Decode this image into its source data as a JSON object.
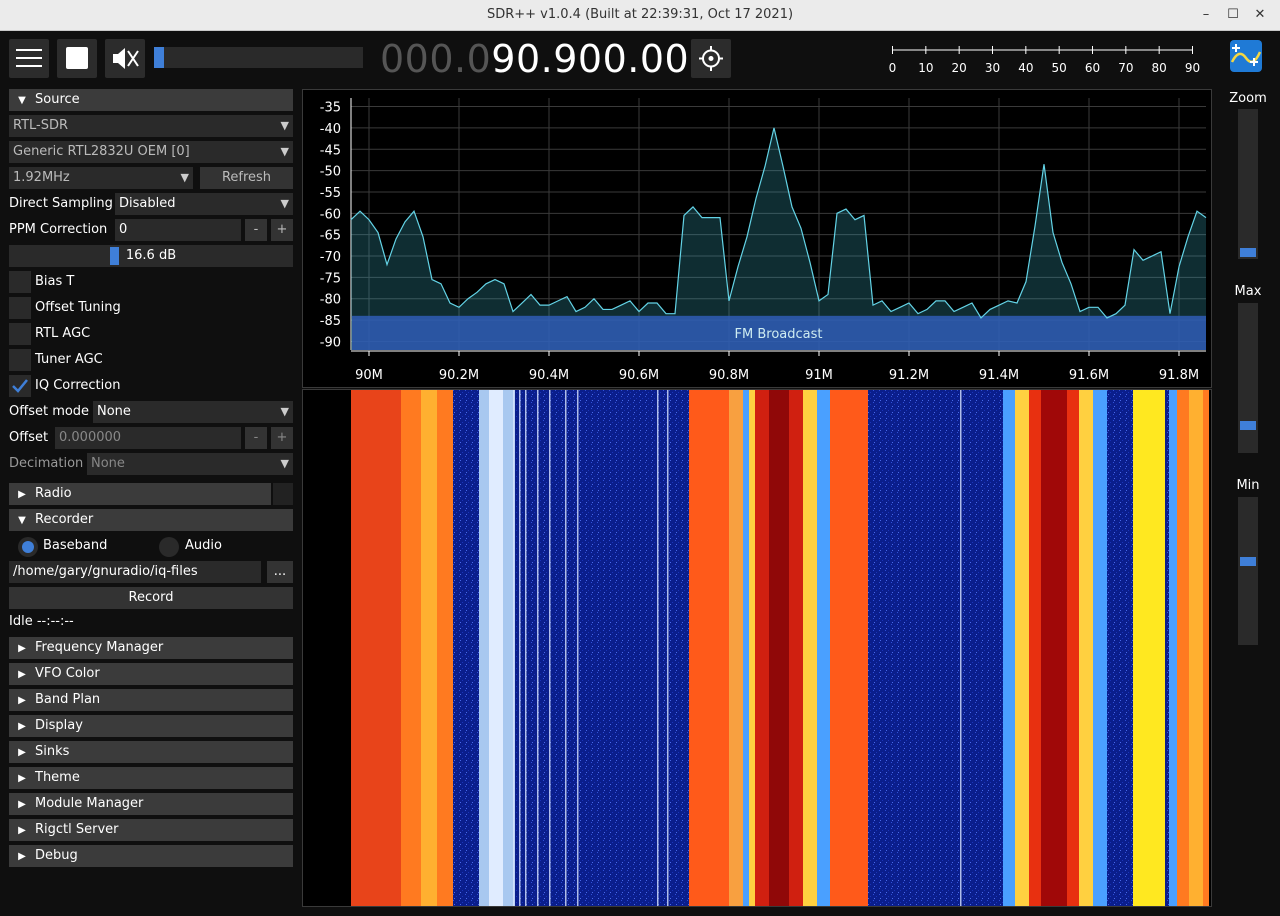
{
  "window": {
    "title": "SDR++ v1.0.4 (Built at 22:39:31, Oct 17 2021)"
  },
  "top": {
    "frequency_dim": "000.0",
    "frequency_bright": "90.900.000",
    "volume_level": 0.05,
    "snr_ticks": [
      "0",
      "10",
      "20",
      "30",
      "40",
      "50",
      "60",
      "70",
      "80",
      "90"
    ]
  },
  "source": {
    "header": "Source",
    "device": "RTL-SDR",
    "device_name": "Generic RTL2832U OEM [0]",
    "sample_rate": "1.92MHz",
    "refresh": "Refresh",
    "direct_sampling_label": "Direct Sampling",
    "direct_sampling_value": "Disabled",
    "ppm_label": "PPM Correction",
    "ppm_value": "0",
    "minus": "-",
    "plus": "+",
    "gain": "16.6 dB",
    "gain_fraction": 0.36,
    "bias_t": "Bias T",
    "offset_tuning": "Offset Tuning",
    "rtl_agc": "RTL AGC",
    "tuner_agc": "Tuner AGC",
    "iq_correction": "IQ Correction",
    "offset_mode_label": "Offset mode",
    "offset_mode_value": "None",
    "offset_label": "Offset",
    "offset_value": "0.000000",
    "decimation_label": "Decimation",
    "decimation_value": "None"
  },
  "radio": {
    "header": "Radio"
  },
  "recorder": {
    "header": "Recorder",
    "baseband": "Baseband",
    "audio": "Audio",
    "path": "/home/gary/gnuradio/iq-files",
    "browse": "...",
    "record": "Record",
    "status": "Idle --:--:--"
  },
  "menus": [
    "Frequency Manager",
    "VFO Color",
    "Band Plan",
    "Display",
    "Sinks",
    "Theme",
    "Module Manager",
    "Rigctl Server",
    "Debug"
  ],
  "right": {
    "zoom": "Zoom",
    "max": "Max",
    "min": "Min",
    "zoom_level": 0.0,
    "max_level": 0.15,
    "min_level": 0.57
  },
  "chart_data": {
    "type": "area",
    "yticks": [
      "-35",
      "-40",
      "-45",
      "-50",
      "-55",
      "-60",
      "-65",
      "-70",
      "-75",
      "-80",
      "-85",
      "-90"
    ],
    "xticks": [
      "90M",
      "90.2M",
      "90.4M",
      "90.6M",
      "90.8M",
      "91M",
      "91.2M",
      "91.4M",
      "91.6M",
      "91.8M"
    ],
    "xlim": [
      89.96,
      91.86
    ],
    "ylim": [
      -92,
      -33
    ],
    "band_label": "FM Broadcast",
    "series": [
      {
        "x": [
          89.96,
          89.98,
          90.0,
          90.02,
          90.04,
          90.06,
          90.08,
          90.1,
          90.12,
          90.14,
          90.16,
          90.18,
          90.2,
          90.22,
          90.24,
          90.26,
          90.28,
          90.3,
          90.32,
          90.34,
          90.36,
          90.38,
          90.4,
          90.42,
          90.44,
          90.46,
          90.48,
          90.5,
          90.52,
          90.54,
          90.56,
          90.58,
          90.6,
          90.62,
          90.64,
          90.66,
          90.68,
          90.7,
          90.72,
          90.74,
          90.76,
          90.78,
          90.8,
          90.82,
          90.84,
          90.86,
          90.88,
          90.9,
          90.92,
          90.94,
          90.96,
          90.98,
          91.0,
          91.02,
          91.04,
          91.06,
          91.08,
          91.1,
          91.12,
          91.14,
          91.16,
          91.18,
          91.2,
          91.22,
          91.24,
          91.26,
          91.28,
          91.3,
          91.32,
          91.34,
          91.36,
          91.38,
          91.4,
          91.42,
          91.44,
          91.46,
          91.48,
          91.5,
          91.52,
          91.54,
          91.56,
          91.58,
          91.6,
          91.62,
          91.64,
          91.66,
          91.68,
          91.7,
          91.72,
          91.74,
          91.76,
          91.78,
          91.8,
          91.82,
          91.84,
          91.86
        ],
        "y": [
          -60,
          -59,
          -62,
          -66,
          -71,
          -66,
          -63,
          -58,
          -65,
          -76,
          -78,
          -80,
          -82,
          -81,
          -77,
          -76,
          -76,
          -78,
          -82,
          -81,
          -80,
          -80,
          -81,
          -81,
          -81,
          -82,
          -82,
          -81,
          -81,
          -82,
          -82,
          -82,
          -82,
          -81,
          -82,
          -82,
          -83,
          -61,
          -60,
          -60,
          -61,
          -62,
          -79,
          -72,
          -66,
          -58,
          -48,
          -40,
          -50,
          -57,
          -63,
          -72,
          -82,
          -78,
          -60,
          -60,
          -60,
          -60,
          -82,
          -82,
          -82,
          -82,
          -82,
          -82,
          -82,
          -81,
          -82,
          -82,
          -82,
          -82,
          -83,
          -82,
          -82,
          -82,
          -80,
          -76,
          -64,
          -47,
          -64,
          -72,
          -78,
          -82,
          -82,
          -83,
          -83,
          -83,
          -82,
          -70,
          -70,
          -70,
          -70,
          -82,
          -72,
          -66,
          -61,
          -60
        ]
      }
    ]
  }
}
